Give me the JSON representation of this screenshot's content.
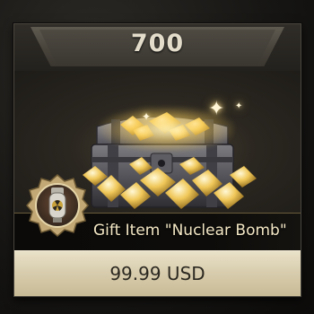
{
  "offer": {
    "diamond_amount": "700",
    "gift_title": "Gift Item \"Nuclear Bomb\"",
    "price_label": "99.99 USD"
  },
  "icons": {
    "chest": "treasure-chest-of-diamonds",
    "badge": "nuclear-bomb-badge",
    "sparkles": "sparkle"
  },
  "colors": {
    "price_text": "#e3dccb",
    "title_text": "#f2e6c4",
    "button_bg": "#d8cdae",
    "button_text": "#2b2820",
    "badge_ring": "#b3986a"
  }
}
